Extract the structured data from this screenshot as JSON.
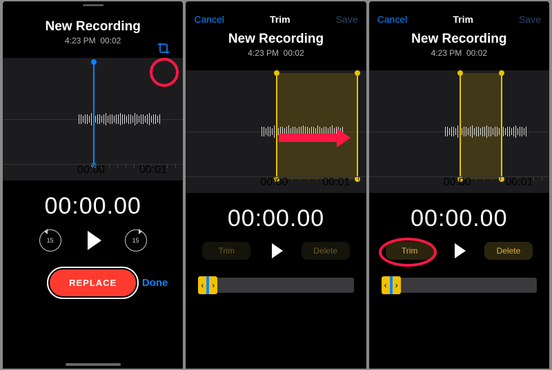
{
  "colors": {
    "accent_blue": "#0a84ff",
    "accent_yellow": "#e6c400",
    "record_red": "#ff3b30",
    "anno_red": "#ff1744"
  },
  "screen1": {
    "title": "New Recording",
    "timestamp": "4:23 PM",
    "duration_short": "00:02",
    "ruler": {
      "t0": "00:00",
      "t1": "00:01"
    },
    "time_display": "00:00.00",
    "skip_back_label": "15",
    "skip_fwd_label": "15",
    "replace_label": "REPLACE",
    "done_label": "Done",
    "trim_icon_name": "trim-icon"
  },
  "screen2": {
    "nav": {
      "cancel": "Cancel",
      "title": "Trim",
      "save": "Save"
    },
    "title": "New Recording",
    "timestamp": "4:23 PM",
    "duration_short": "00:02",
    "ruler": {
      "t0": "00:00",
      "t1": "00:01"
    },
    "time_display": "00:00.00",
    "trim_label": "Trim",
    "delete_label": "Delete"
  },
  "screen3": {
    "nav": {
      "cancel": "Cancel",
      "title": "Trim",
      "save": "Save"
    },
    "title": "New Recording",
    "timestamp": "4:23 PM",
    "duration_short": "00:02",
    "ruler": {
      "t0": "00:00",
      "t1": "00:01"
    },
    "time_display": "00:00.00",
    "trim_label": "Trim",
    "delete_label": "Delete"
  }
}
